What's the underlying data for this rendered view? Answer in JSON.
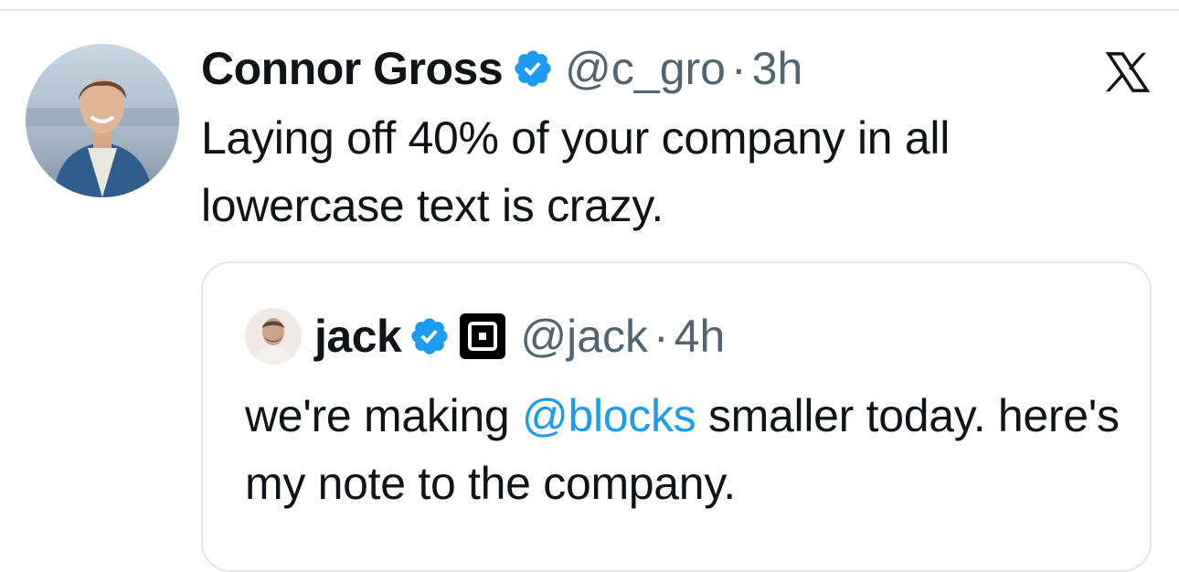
{
  "tweet": {
    "author": {
      "display_name": "Connor Gross",
      "handle": "@c_gro",
      "verified": true
    },
    "separator": "·",
    "time": "3h",
    "text": "Laying off 40% of your company in all lowercase text is crazy.",
    "platform_icon": "x-logo-icon"
  },
  "quoted_tweet": {
    "author": {
      "display_name": "jack",
      "handle": "@jack",
      "verified": true,
      "affiliate_badge": "block-logo-icon"
    },
    "separator": "·",
    "time": "4h",
    "text_before": "we're making ",
    "mention": "@blocks",
    "text_after": " smaller today. here's my note to the company."
  },
  "colors": {
    "accent": "#1d9bf0",
    "text": "#0f1419",
    "muted": "#536471",
    "border": "#e2e6e9"
  }
}
